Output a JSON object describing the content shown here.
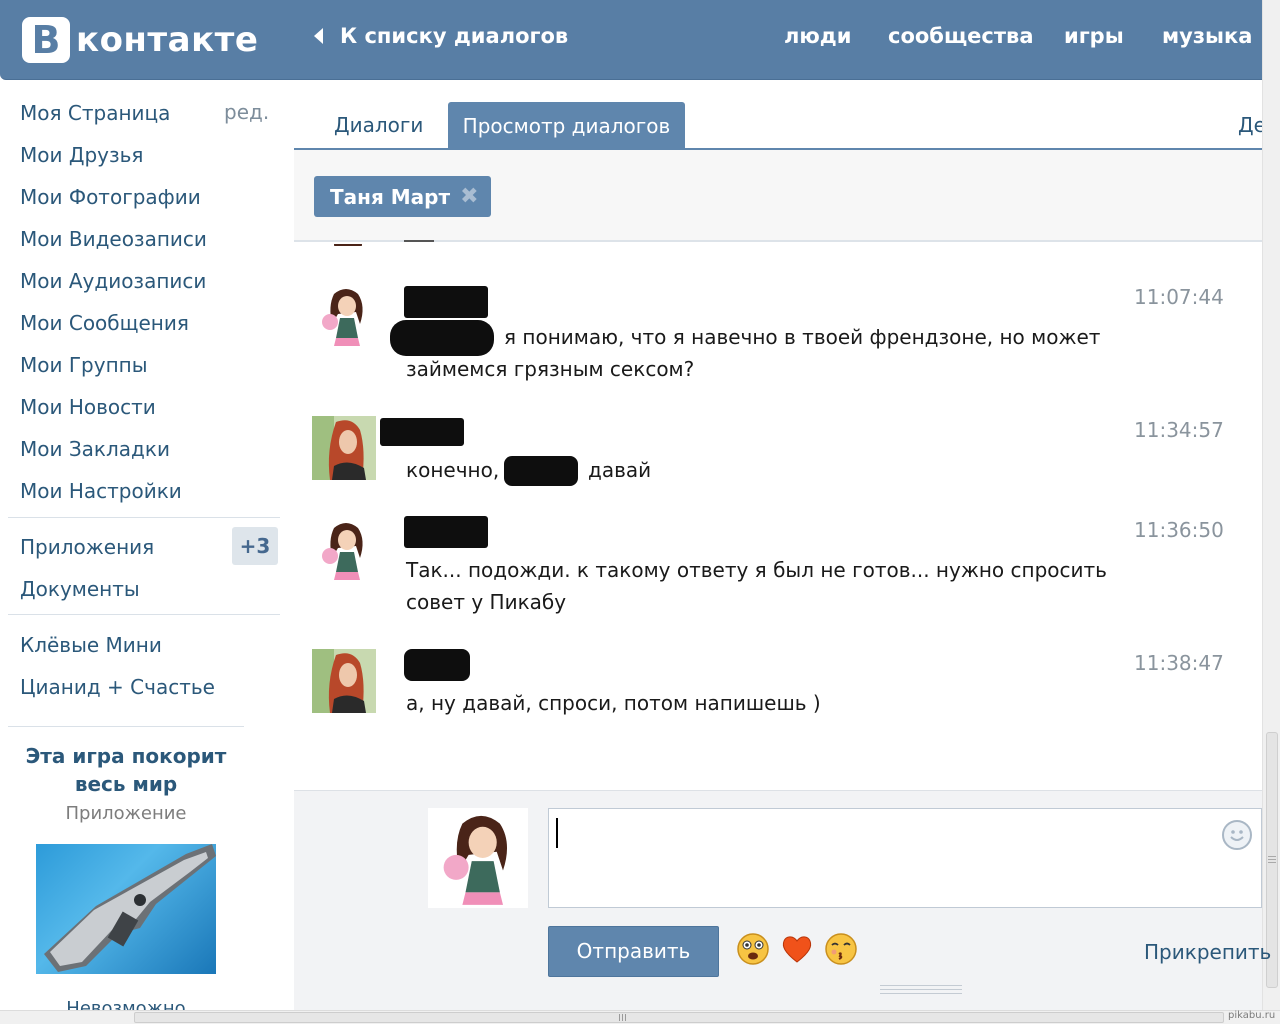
{
  "header": {
    "logo_letter": "В",
    "logo_text": "контакте",
    "back_label": "К списку диалогов",
    "nav": [
      "люди",
      "сообщества",
      "игры",
      "музыка"
    ]
  },
  "sidebar": {
    "edit_label": "ред.",
    "items": [
      "Моя Страница",
      "Мои Друзья",
      "Мои Фотографии",
      "Мои Видеозаписи",
      "Мои Аудиозаписи",
      "Мои Сообщения",
      "Мои Группы",
      "Мои Новости",
      "Мои Закладки",
      "Мои Настройки"
    ],
    "apps_label": "Приложения",
    "apps_badge": "+3",
    "docs_label": "Документы",
    "groups": [
      "Клёвые Мини",
      "Цианид + Счастье"
    ],
    "ad": {
      "title": "Эта игра покорит весь мир",
      "subtitle": "Приложение",
      "caption": "Невозможно"
    }
  },
  "tabs": {
    "dialogs": "Диалоги",
    "view_dialogs": "Просмотр диалогов",
    "cut_tab": "Де"
  },
  "filter_chip": {
    "name": "Таня Март"
  },
  "messages": [
    {
      "text": "",
      "time": ""
    },
    {
      "text": "я понимаю, что я навечно в твоей френдзоне, но может",
      "text2": "займемся грязным сексом?",
      "time": "11:07:44"
    },
    {
      "text_a": "конечно,",
      "text_b": "давай",
      "time": "11:34:57"
    },
    {
      "text": "Так... подожди. к такому ответу я был не готов... нужно спросить",
      "text2": "совет у Пикабу",
      "time": "11:36:50"
    },
    {
      "text": "а, ну давай, спроси, потом напишешь )",
      "time": "11:38:47"
    }
  ],
  "compose": {
    "value": "",
    "send_label": "Отправить",
    "attach_label": "Прикрепить"
  },
  "watermark": "pikabu.ru",
  "colors": {
    "header": "#587ea5",
    "accent": "#5f86ad",
    "link": "#2b587a"
  }
}
